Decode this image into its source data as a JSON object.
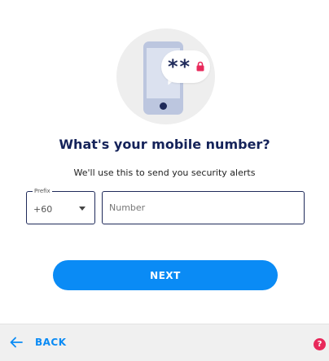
{
  "header": {
    "title": "What's your mobile number?",
    "subtitle": "We'll use this to send you security alerts"
  },
  "illustration": {
    "bubble_text": "**",
    "icons": [
      "phone-icon",
      "chat-bubble-icon",
      "lock-icon"
    ]
  },
  "form": {
    "prefix": {
      "label": "Prefix",
      "value": "+60"
    },
    "number": {
      "placeholder": "Number",
      "value": ""
    },
    "next_label": "NEXT"
  },
  "footer": {
    "back_label": "BACK",
    "help_symbol": "?"
  },
  "colors": {
    "primary": "#0a8bf5",
    "title": "#15235a",
    "help": "#e8295b",
    "lock": "#e8295b"
  }
}
